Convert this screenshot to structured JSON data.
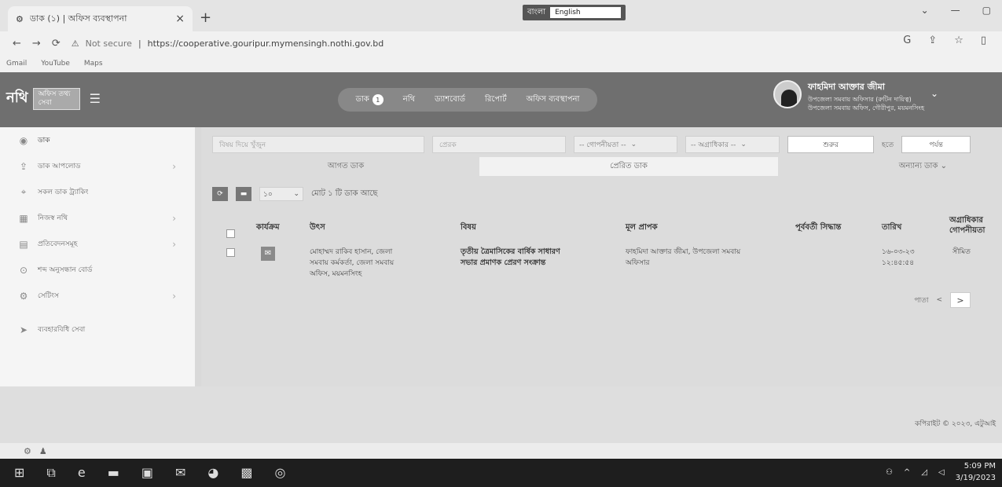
{
  "browser": {
    "tab_title": "ডাক (১) | অফিস ব্যবস্থাপনা",
    "tab_close": "×",
    "new_tab": "+",
    "not_secure": "Not secure",
    "url": "https://cooperative.gouripur.mymensingh.nothi.gov.bd",
    "ime_label": "বাংলা",
    "ime_select": "English",
    "bookmarks": [
      "Gmail",
      "YouTube",
      "Maps"
    ]
  },
  "header": {
    "logo_text": "নথি",
    "logo_box": "অফিস তথ্য সেবা",
    "modules": {
      "dak": "ডাক",
      "dak_count": "1",
      "nothi": "নথি",
      "dashboard": "ড্যাশবোর্ড",
      "report": "রিপোর্ট",
      "office_management": "অফিস ব্যবস্থাপনা"
    },
    "user": {
      "name": "ফাহমিদা আক্তার জীমা",
      "designation_line1": "উপজেলা সমবায় অফিসার (রুটিন দায়িত্ব)",
      "designation_line2": "উপজেলা সমবায় অফিস, গৌরীপুর, ময়মনসিংহ"
    }
  },
  "sidebar": {
    "items": [
      {
        "label": "ডাক",
        "icon": "inbox-icon"
      },
      {
        "label": "ডাক আপলোড",
        "icon": "upload-icon"
      },
      {
        "label": "সকল ডাক ট্র্যাকিং",
        "icon": "tracking-icon"
      },
      {
        "label": "নিজস্ব নথি",
        "icon": "folder-icon"
      },
      {
        "label": "প্রতিবেদনসমূহ",
        "icon": "report-icon"
      },
      {
        "label": "শব্দ অনুসন্ধান বোর্ড",
        "icon": "search-board-icon"
      },
      {
        "label": "সেটিংস",
        "icon": "settings-icon"
      },
      {
        "label": "ব্যবহারবিধি সেবা",
        "icon": "help-icon"
      }
    ]
  },
  "filters": {
    "search_placeholder": "বিষয় দিয়ে খুঁজুন",
    "sender_placeholder": "প্রেরক",
    "confidentiality": "-- গোপনীয়তা --",
    "priority": "-- অগ্রাধিকার --",
    "from_date": "শুরুর",
    "to_label": "হতে",
    "to_date": "পর্যন্ত"
  },
  "tabs": {
    "incoming": "আগত ডাক",
    "sent": "প্রেরিত ডাক",
    "other": "অন্যান্য ডাক"
  },
  "toolbar": {
    "page_size": "১০",
    "total": "মোট ১ টি ডাক আছে"
  },
  "table": {
    "headers": {
      "action": "কার্যক্রম",
      "source": "উৎস",
      "subject": "বিষয়",
      "main_recipient": "মূল প্রাপক",
      "previous_decision": "পূর্ববর্তী সিদ্ধান্ত",
      "date": "তারিখ",
      "priority_line1": "অগ্রাধিকার",
      "priority_line2": "গোপনীয়তা"
    },
    "rows": [
      {
        "source_line1": "মোহাম্মদ রাকিব হাসান, জেলা",
        "source_line2": "সমবায় কর্মকর্তা, জেলা সমবায়",
        "source_line3": "অফিস, ময়মনসিংহ",
        "subject_line1": "তৃতীয় ত্রৈমাসিকের বার্ষিক সাধারণ",
        "subject_line2": "সভার প্রমাণক প্রেরণ সংক্রান্ত",
        "recipient_line1": "ফাহমিদা আক্তার জীমা, উপজেলা সমবায়",
        "recipient_line2": "অফিসার",
        "date_line1": "১৬-০৩-২৩",
        "date_line2": "১২:৪৫:৫৪",
        "priority": "সীমিত"
      }
    ]
  },
  "pager": {
    "label": "পাতা",
    "prev": "<",
    "next": ">"
  },
  "footer": {
    "copyright": "কপিরাইট © ২০২৩, এটুআই"
  },
  "taskbar": {
    "time": "5:09 PM",
    "date": "3/19/2023"
  }
}
